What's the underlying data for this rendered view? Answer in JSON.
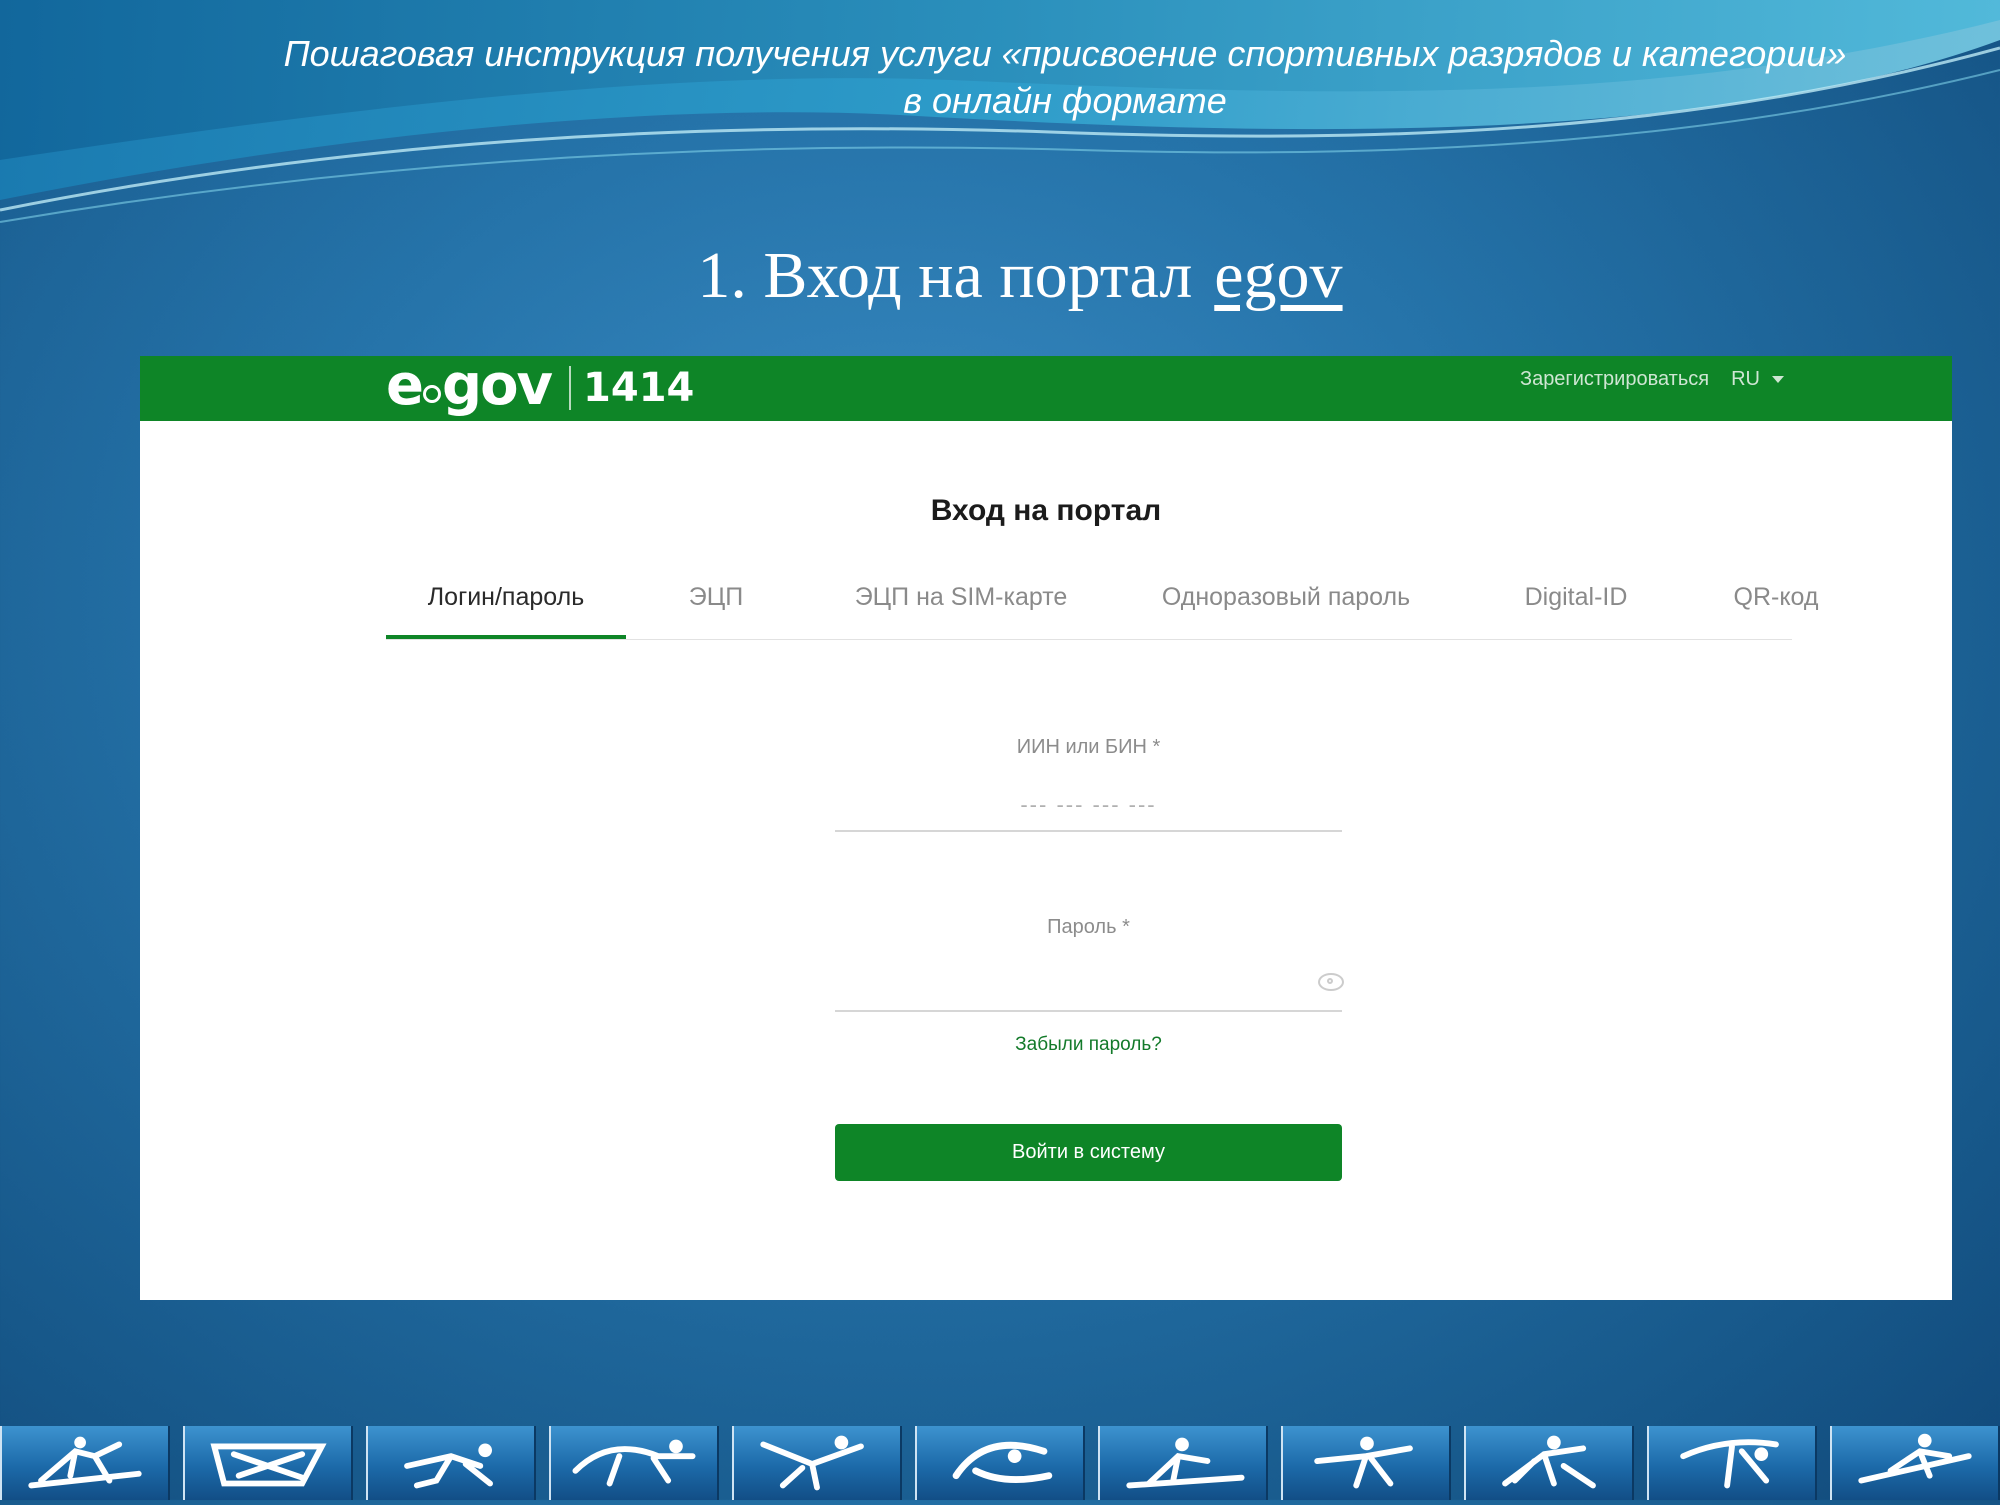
{
  "slide": {
    "header": "Пошаговая инструкция получения услуги «присвоение спортивных разрядов и категории» в онлайн формате",
    "step_title": "1. Вход на портал",
    "step_link": "egov"
  },
  "portal": {
    "logo": {
      "brand": "egov",
      "number": "1414"
    },
    "top_nav": {
      "register": "Зарегистрироваться",
      "language": "RU"
    },
    "title": "Вход на портал",
    "tabs": [
      {
        "label": "Логин/пароль",
        "active": true
      },
      {
        "label": "ЭЦП",
        "active": false
      },
      {
        "label": "ЭЦП на SIM-карте",
        "active": false
      },
      {
        "label": "Одноразовый пароль",
        "active": false
      },
      {
        "label": "Digital-ID",
        "active": false
      },
      {
        "label": "QR-код",
        "active": false
      }
    ],
    "fields": {
      "iin": {
        "label": "ИИН или БИН *",
        "placeholder": "--- --- --- ---",
        "value": ""
      },
      "password": {
        "label": "Пароль *",
        "value": "",
        "toggle_icon": "eye-icon"
      }
    },
    "forgot_link": "Забыли пароль?",
    "submit_label": "Войти в систему"
  },
  "colors": {
    "brand_green": "#0e8527",
    "slide_blue": "#2573a9",
    "link_green": "#137a2a"
  },
  "footer_sports": [
    "cross-country-skiing",
    "luge",
    "speed-skating",
    "ice-hockey",
    "ski-jumping",
    "figure-skating",
    "skiing",
    "snowboard",
    "biathlon",
    "freestyle",
    "alpine-skiing"
  ]
}
